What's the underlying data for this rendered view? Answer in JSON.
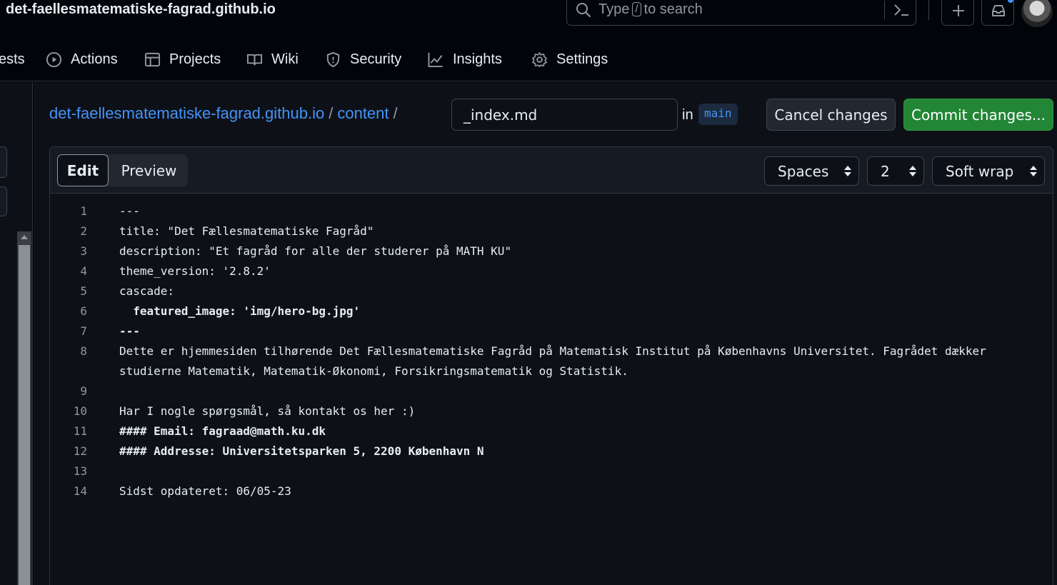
{
  "header": {
    "repo_title": "det-faellesmatematiske-fagrad.github.io",
    "search": {
      "prefix": "Type",
      "key": "/",
      "suffix": "to search"
    },
    "icons": [
      "search-icon",
      "terminal-icon",
      "plus-icon",
      "inbox-icon",
      "avatar"
    ]
  },
  "nav": {
    "items": [
      {
        "label": "ests",
        "icon": ""
      },
      {
        "label": "Actions",
        "icon": "play-icon"
      },
      {
        "label": "Projects",
        "icon": "table-icon"
      },
      {
        "label": "Wiki",
        "icon": "book-icon"
      },
      {
        "label": "Security",
        "icon": "shield-icon"
      },
      {
        "label": "Insights",
        "icon": "graph-icon"
      },
      {
        "label": "Settings",
        "icon": "gear-icon"
      }
    ]
  },
  "breadcrumb": {
    "repo": "det-faellesmatematiske-fagrad.github.io",
    "sep": "/",
    "folder": "content"
  },
  "file": {
    "name": "_index.md",
    "in_label": "in",
    "branch": "main"
  },
  "actions": {
    "cancel": "Cancel changes",
    "commit": "Commit changes..."
  },
  "editor": {
    "tabs": {
      "edit": "Edit",
      "preview": "Preview"
    },
    "indent_mode": "Spaces",
    "indent_size": "2",
    "wrap_mode": "Soft wrap",
    "lines": [
      {
        "n": "1",
        "text": "---",
        "bold": false
      },
      {
        "n": "2",
        "text": "title: \"Det Fællesmatematiske Fagråd\"",
        "bold": false
      },
      {
        "n": "3",
        "text": "description: \"Et fagråd for alle der studerer på MATH KU\"",
        "bold": false
      },
      {
        "n": "4",
        "text": "theme_version: '2.8.2'",
        "bold": false
      },
      {
        "n": "5",
        "text": "cascade:",
        "bold": false
      },
      {
        "n": "6",
        "text": "  featured_image: 'img/hero-bg.jpg'",
        "bold": true
      },
      {
        "n": "7",
        "text": "---",
        "bold": true
      },
      {
        "n": "8",
        "text": "Dette er hjemmesiden tilhørende Det Fællesmatematiske Fagråd på Matematisk Institut på Københavns Universitet. Fagrådet dækker studierne Matematik, Matematik-Økonomi, Forsikringsmatematik og Statistik.",
        "bold": false
      },
      {
        "n": "9",
        "text": "",
        "bold": false
      },
      {
        "n": "10",
        "text": "Har I nogle spørgsmål, så kontakt os her :)",
        "bold": false
      },
      {
        "n": "11",
        "text": "#### Email: fagraad@math.ku.dk",
        "bold": true
      },
      {
        "n": "12",
        "text": "#### Addresse: Universitetsparken 5, 2200 København N",
        "bold": true
      },
      {
        "n": "13",
        "text": "",
        "bold": false
      },
      {
        "n": "14",
        "text": "Sidst opdateret: 06/05-23",
        "bold": false
      }
    ]
  }
}
